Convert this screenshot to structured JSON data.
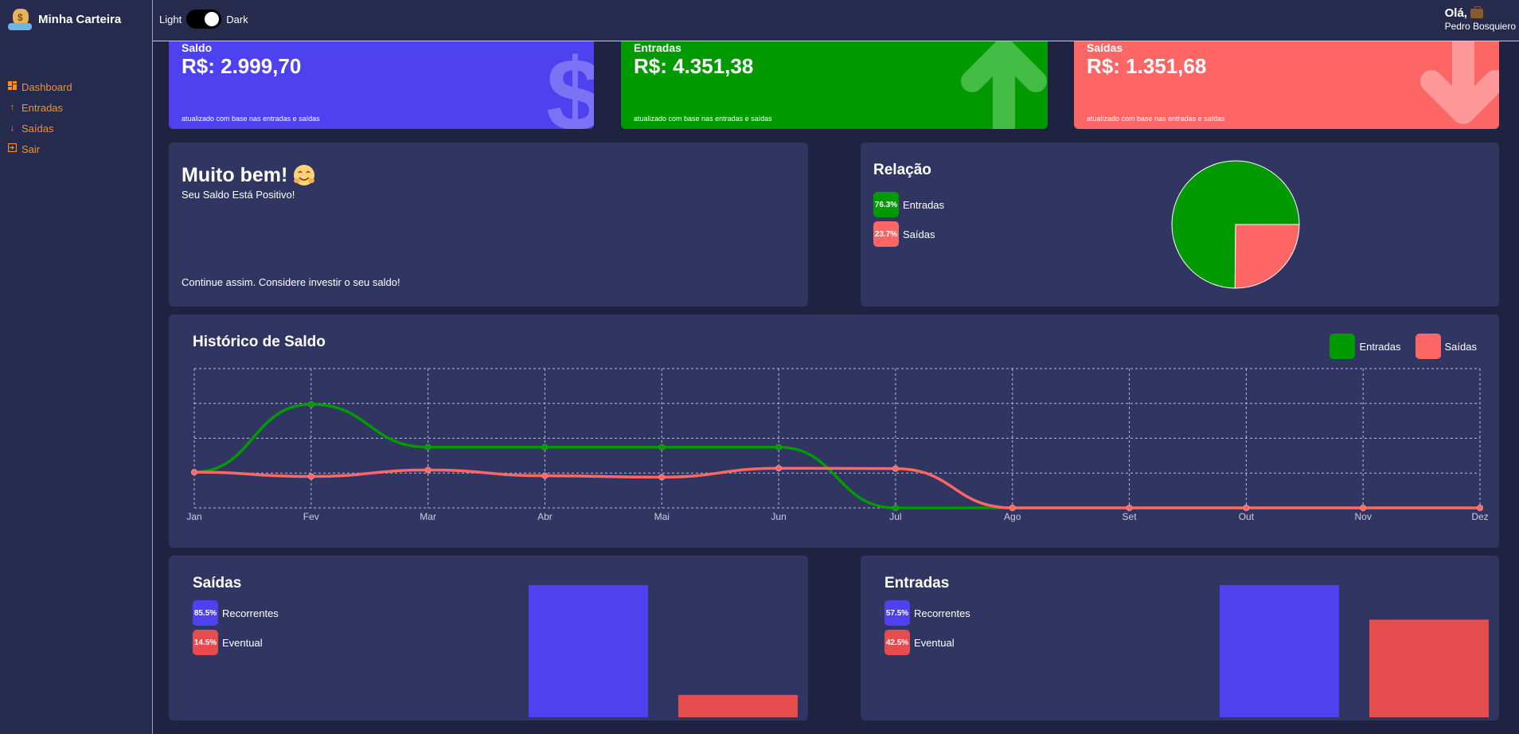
{
  "app": {
    "title": "Minha Carteira"
  },
  "sidebar": {
    "items": [
      {
        "label": "Dashboard",
        "icon": "dashboard-icon"
      },
      {
        "label": "Entradas",
        "icon": "arrow-up-icon"
      },
      {
        "label": "Saídas",
        "icon": "arrow-down-icon"
      },
      {
        "label": "Sair",
        "icon": "exit-icon"
      }
    ]
  },
  "header": {
    "theme_light": "Light",
    "theme_dark": "Dark",
    "greeting": "Olá,",
    "user_name": "Pedro Bosquiero"
  },
  "colors": {
    "accent": "#f7931e",
    "saldo": "#4e41f0",
    "entradas": "#009900",
    "saidas": "#ff6666",
    "eventual": "#e44c4e",
    "panel": "#303661"
  },
  "wallet_cards": [
    {
      "label": "Saldo",
      "amount": "R$: 2.999,70",
      "footer": "atualizado com base nas entradas e saídas",
      "icon": "dollar-icon"
    },
    {
      "label": "Entradas",
      "amount": "R$: 4.351,38",
      "footer": "atualizado com base nas entradas e saídas",
      "icon": "arrow-up-icon"
    },
    {
      "label": "Saídas",
      "amount": "R$: 1.351,68",
      "footer": "atualizado com base nas entradas e saídas",
      "icon": "arrow-down-icon"
    }
  ],
  "message": {
    "title": "Muito bem!",
    "subtitle": "Seu Saldo Está Positivo!",
    "footer": "Continue assim. Considere investir o seu saldo!"
  },
  "relacao": {
    "title": "Relação",
    "items": [
      {
        "percent": "76.3%",
        "label": "Entradas",
        "value": 76.3
      },
      {
        "percent": "23.7%",
        "label": "Saídas",
        "value": 23.7
      }
    ]
  },
  "historico": {
    "title": "Histórico de Saldo",
    "legend": [
      "Entradas",
      "Saídas"
    ]
  },
  "saidas_panel": {
    "title": "Saídas",
    "items": [
      {
        "percent": "85.5%",
        "label": "Recorrentes",
        "value": 85.5
      },
      {
        "percent": "14.5%",
        "label": "Eventual",
        "value": 14.5
      }
    ]
  },
  "entradas_panel": {
    "title": "Entradas",
    "items": [
      {
        "percent": "57.5%",
        "label": "Recorrentes",
        "value": 57.5
      },
      {
        "percent": "42.5%",
        "label": "Eventual",
        "value": 42.5
      }
    ]
  },
  "chart_data": [
    {
      "type": "pie",
      "labels": [
        "Entradas",
        "Saídas"
      ],
      "values": [
        76.3,
        23.7
      ]
    },
    {
      "type": "line",
      "title": "Histórico de Saldo",
      "categories": [
        "Jan",
        "Fev",
        "Mar",
        "Abr",
        "Mai",
        "Jun",
        "Jul",
        "Ago",
        "Set",
        "Out",
        "Nov",
        "Dez"
      ],
      "series": [
        {
          "name": "Entradas",
          "values": [
            1000,
            2900,
            1700,
            1700,
            1700,
            1700,
            0,
            0,
            0,
            0,
            0,
            0
          ]
        },
        {
          "name": "Saídas",
          "values": [
            1000,
            880,
            1060,
            900,
            860,
            1110,
            1100,
            0,
            0,
            0,
            0,
            0
          ]
        }
      ],
      "ylim": [
        0,
        3900
      ],
      "grid": true,
      "legend": "top-right"
    },
    {
      "type": "bar",
      "title": "Saídas",
      "categories": [
        "Recorrentes",
        "Eventual"
      ],
      "values": [
        85.5,
        14.5
      ]
    },
    {
      "type": "bar",
      "title": "Entradas",
      "categories": [
        "Recorrentes",
        "Eventual"
      ],
      "values": [
        57.5,
        42.5
      ]
    }
  ]
}
